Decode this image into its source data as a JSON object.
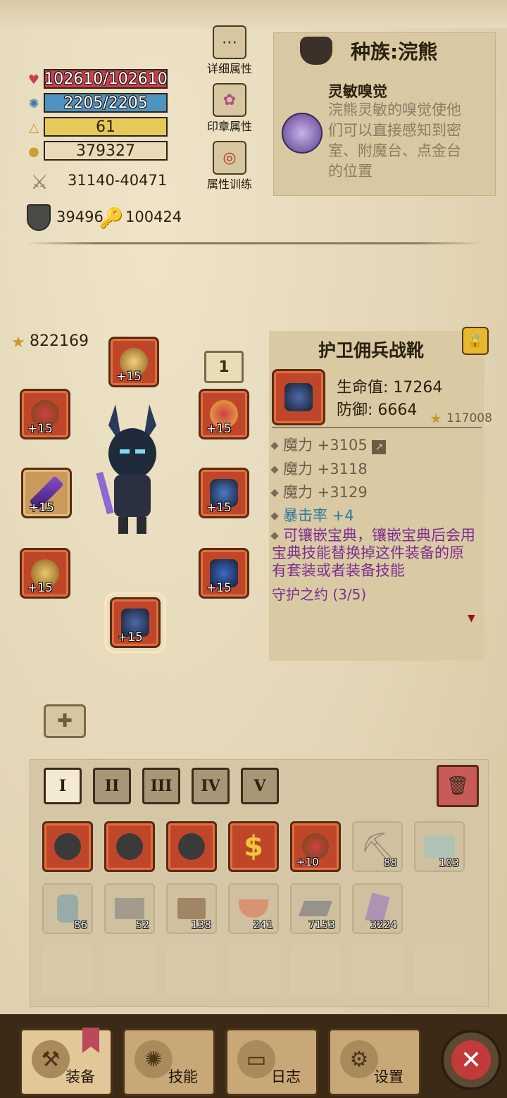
{
  "stats": {
    "hp": "102610/102610",
    "mp": "2205/2205",
    "level": "61",
    "gold": "379327",
    "attack": "31140-40471",
    "defense": "39496",
    "magic": "100424"
  },
  "side_buttons": {
    "detail": "详细属性",
    "seal": "印章属性",
    "training": "属性训练"
  },
  "race": {
    "title": "种族:浣熊",
    "skill_name": "灵敏嗅觉",
    "skill_desc": "浣熊灵敏的嗅觉使他们可以直接感知到密室、附魔台、点金台的位置"
  },
  "equipment": {
    "total_score": "822169",
    "plus_label": "+15",
    "set_count_badge": "1"
  },
  "item_detail": {
    "name": "护卫佣兵战靴",
    "hp": "生命值: 17264",
    "defense": "防御: 6664",
    "score": "117008",
    "attrs": [
      "魔力 +3105",
      "魔力 +3118",
      "魔力 +3129"
    ],
    "crit": "暴击率 +4",
    "note": "可镶嵌宝典，镶嵌宝典后会用宝典技能替换掉这件装备的原有套装或者装备技能",
    "set_name": "守护之约 (3/5)"
  },
  "tabs": [
    "I",
    "II",
    "III",
    "IV",
    "V"
  ],
  "inventory": {
    "row1_plus": "+10",
    "counts1": [
      "88",
      "103"
    ],
    "counts2": [
      "86",
      "52",
      "138",
      "241",
      "7153",
      "3224"
    ]
  },
  "nav": [
    "装备",
    "技能",
    "日志",
    "设置"
  ],
  "colors": {
    "hp": "#c6404f",
    "mp": "#4f93c2",
    "level": "#e7c95a",
    "rare_text": "#7b2f8f",
    "crit_text": "#2f7a9a"
  }
}
